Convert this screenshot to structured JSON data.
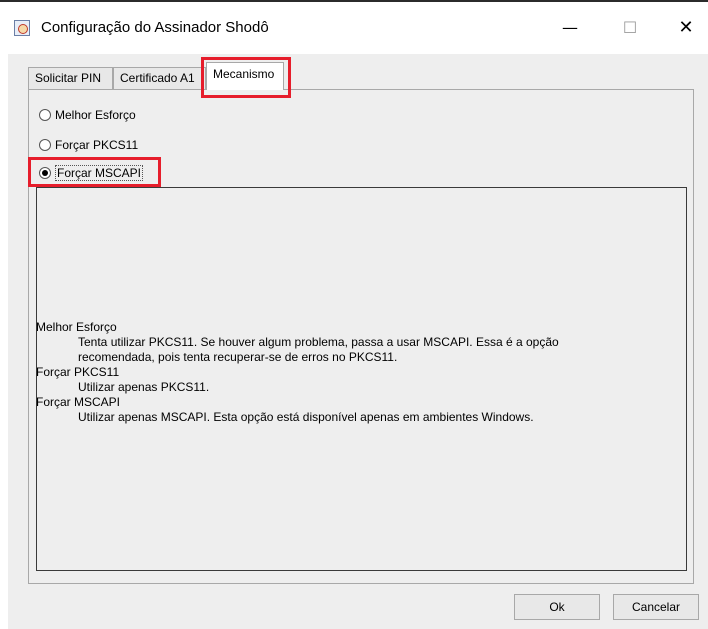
{
  "window": {
    "title": "Configuração do Assinador Shodô",
    "app_icon": "java-icon",
    "controls": {
      "minimize": "—",
      "maximize": "☐",
      "close": "✕"
    }
  },
  "tabs": [
    {
      "label": "Solicitar PIN",
      "selected": false
    },
    {
      "label": "Certificado A1",
      "selected": false
    },
    {
      "label": "Mecanismo",
      "selected": true
    }
  ],
  "mechanism": {
    "options": [
      {
        "label": "Melhor Esforço",
        "checked": false
      },
      {
        "label": "Forçar PKCS11",
        "checked": false
      },
      {
        "label": "Forçar MSCAPI",
        "checked": true
      }
    ],
    "description": [
      {
        "heading": "Melhor Esforço",
        "lines": [
          "Tenta utilizar PKCS11. Se houver algum problema, passa a usar MSCAPI. Essa é a opção",
          "recomendada, pois tenta recuperar-se de erros no PKCS11."
        ]
      },
      {
        "heading": "Forçar PKCS11",
        "lines": [
          "Utilizar apenas PKCS11."
        ]
      },
      {
        "heading": "Forçar MSCAPI",
        "lines": [
          "Utilizar apenas MSCAPI. Esta opção está disponível apenas em ambientes Windows."
        ]
      }
    ]
  },
  "buttons": {
    "ok": "Ok",
    "cancel": "Cancelar"
  },
  "highlight_color": "#e61d2b"
}
